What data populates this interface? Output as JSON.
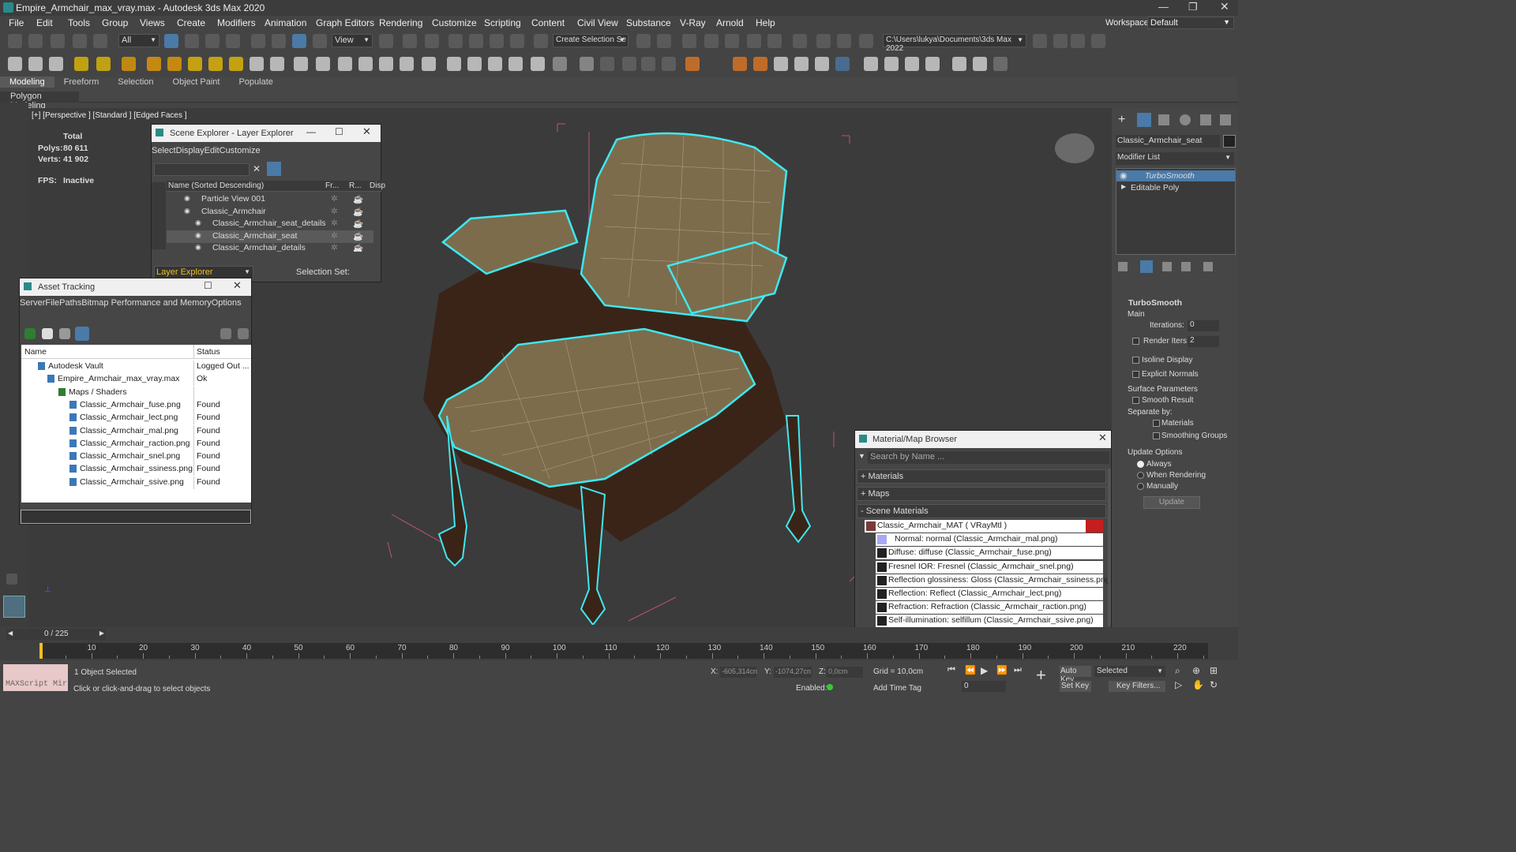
{
  "window": {
    "title": "Empire_Armchair_max_vray.max - Autodesk 3ds Max 2020",
    "workspaces_label": "Workspaces:",
    "workspace_value": "Default"
  },
  "menu": [
    "File",
    "Edit",
    "Tools",
    "Group",
    "Views",
    "Create",
    "Modifiers",
    "Animation",
    "Graph Editors",
    "Rendering",
    "Customize",
    "Scripting",
    "Content",
    "Civil View",
    "Substance",
    "V-Ray",
    "Arnold",
    "Help"
  ],
  "toolbar": {
    "filter": "All",
    "refcoord": "View",
    "selection_set": "Create Selection Se",
    "project_path": "C:\\Users\\lukya\\Documents\\3ds Max 2022"
  },
  "ribbon": {
    "tabs": [
      "Modeling",
      "Freeform",
      "Selection",
      "Object Paint",
      "Populate"
    ],
    "sub": "Polygon Modeling"
  },
  "viewport": {
    "label": "[+] [Perspective ] [Standard ] [Edged Faces ]",
    "stats_total": "Total",
    "polys_label": "Polys:",
    "polys": "80 611",
    "verts_label": "Verts:",
    "verts": "41 902",
    "fps_label": "FPS:",
    "fps": "Inactive"
  },
  "scene_explorer": {
    "title": "Scene Explorer - Layer Explorer",
    "menu": [
      "Select",
      "Display",
      "Edit",
      "Customize"
    ],
    "cols": [
      "Name (Sorted Descending)",
      "Fr...",
      "R...",
      "Disp"
    ],
    "rows": [
      "Particle View 001",
      "Classic_Armchair",
      "Classic_Armchair_seat_details",
      "Classic_Armchair_seat",
      "Classic_Armchair_details"
    ],
    "footer_layer": "Layer Explorer",
    "footer_sel": "Selection Set:"
  },
  "asset": {
    "title": "Asset Tracking",
    "menu": [
      "Server",
      "File",
      "Paths",
      "Bitmap Performance and Memory",
      "Options"
    ],
    "cols": [
      "Name",
      "Status"
    ],
    "rows": [
      [
        "Autodesk Vault",
        "Logged Out ..."
      ],
      [
        "Empire_Armchair_max_vray.max",
        "Ok"
      ],
      [
        "Maps / Shaders",
        ""
      ],
      [
        "Classic_Armchair_fuse.png",
        "Found"
      ],
      [
        "Classic_Armchair_lect.png",
        "Found"
      ],
      [
        "Classic_Armchair_mal.png",
        "Found"
      ],
      [
        "Classic_Armchair_raction.png",
        "Found"
      ],
      [
        "Classic_Armchair_snel.png",
        "Found"
      ],
      [
        "Classic_Armchair_ssiness.png",
        "Found"
      ],
      [
        "Classic_Armchair_ssive.png",
        "Found"
      ]
    ]
  },
  "matbrowser": {
    "title": "Material/Map Browser",
    "search": "Search by Name ...",
    "groups": [
      "+ Materials",
      "+ Maps",
      "- Scene Materials"
    ],
    "items": [
      "Classic_Armchair_MAT  ( VRayMtl )",
      "Normal: normal (Classic_Armchair_mal.png)",
      "Diffuse: diffuse (Classic_Armchair_fuse.png)",
      "Fresnel IOR: Fresnel (Classic_Armchair_snel.png)",
      "Reflection glossiness: Gloss (Classic_Armchair_ssiness.png)",
      "Reflection: Reflect (Classic_Armchair_lect.png)",
      "Refraction: Refraction (Classic_Armchair_raction.png)",
      "Self-illumination: selfillum (Classic_Armchair_ssive.png)"
    ]
  },
  "modify": {
    "object_name": "Classic_Armchair_seat",
    "modifier_list": "Modifier List",
    "stack": [
      "TurboSmooth",
      "Editable Poly"
    ],
    "rollout": "TurboSmooth",
    "main": "Main",
    "iterations_label": "Iterations:",
    "iterations": "0",
    "render_iters_label": "Render Iters:",
    "render_iters": "2",
    "isoline": "Isoline Display",
    "explicit": "Explicit Normals",
    "surface": "Surface Parameters",
    "smooth": "Smooth Result",
    "separate": "Separate by:",
    "materials": "Materials",
    "smoothing": "Smoothing Groups",
    "update_opts": "Update Options",
    "always": "Always",
    "when_rendering": "When Rendering",
    "manually": "Manually",
    "update": "Update"
  },
  "timeline": {
    "frame": "0 / 225",
    "ticks": [
      "10",
      "20",
      "30",
      "40",
      "50",
      "60",
      "70",
      "80",
      "90",
      "100",
      "110",
      "120",
      "130",
      "140",
      "150",
      "160",
      "170",
      "180",
      "190",
      "200",
      "210",
      "220"
    ]
  },
  "status": {
    "maxscript": "MAXScript Mir",
    "selected": "1 Object Selected",
    "prompt": "Click or click-and-drag to select objects",
    "x_label": "X:",
    "x": "-605,314cn",
    "y_label": "Y:",
    "y": "-1074,27cn",
    "z_label": "Z:",
    "z": "0,0cm",
    "grid": "Grid = 10,0cm",
    "enabled": "Enabled:",
    "addtime": "Add Time Tag",
    "autokey": "Auto Key",
    "setkey": "Set Key",
    "selected_dd": "Selected",
    "frame_val": "0",
    "keyfilters": "Key Filters..."
  }
}
